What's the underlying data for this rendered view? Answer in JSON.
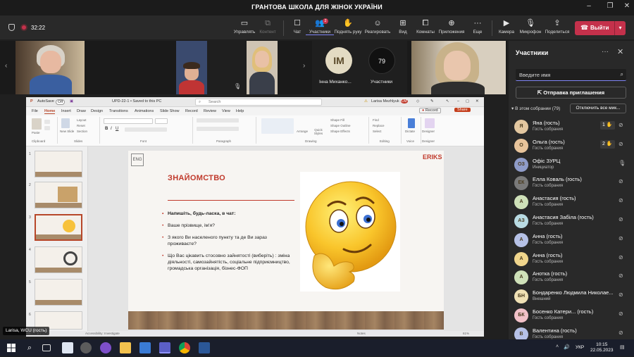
{
  "window": {
    "title": "ГРАНТОВА ШКОЛА ДЛЯ ЖІНОК УКРАЇНИ",
    "controls": [
      "–",
      "❐",
      "✕"
    ]
  },
  "meeting": {
    "elapsed": "32:22",
    "toolbar": {
      "manage": "Управлять",
      "content": "Контент",
      "chat": "Чат",
      "participants": "Участники",
      "participants_badge": "2",
      "raise_hand": "Поднять руку",
      "react": "Реагировать",
      "view": "Вид",
      "rooms": "Комнаты",
      "apps": "Приложения",
      "more": "Еще",
      "camera": "Камера",
      "mic": "Микрофон",
      "share": "Поделиться",
      "leave": "Выйти"
    }
  },
  "strip": {
    "tile_im_initials": "IM",
    "tile_im_name": "Інна Миханко...",
    "more_count": "79",
    "more_label": "Участники"
  },
  "ppt": {
    "app": "AutoSave",
    "toggle": "Off",
    "filename": "UPD-22-1 • Saved to this PC",
    "search": "Search",
    "user": "Larisa Mezhlyuk",
    "user_initials": "LM",
    "menu": [
      "File",
      "Home",
      "Insert",
      "Draw",
      "Design",
      "Transitions",
      "Animations",
      "Slide Show",
      "Record",
      "Review",
      "View",
      "Help"
    ],
    "record_btn": "Record",
    "share_btn": "Share",
    "ribbon_groups": [
      "Clipboard",
      "Slides",
      "Font",
      "Paragraph",
      "Drawing",
      "Editing",
      "Voice",
      "Designer"
    ],
    "ribbon_labels": {
      "paste": "Paste",
      "new_slide": "New Slide",
      "layout": "Layout",
      "reset": "Reset",
      "section": "Section",
      "arrange": "Arrange",
      "quick_styles": "Quick Styles",
      "shape_fill": "Shape Fill",
      "shape_outline": "Shape Outline",
      "shape_effects": "Shape Effects",
      "find": "Find",
      "replace": "Replace",
      "select": "Select",
      "dictate": "Dictate",
      "designer": "Designer"
    },
    "thumbnails": [
      "1",
      "2",
      "3",
      "4",
      "5",
      "6"
    ],
    "status": {
      "slide": "Slide 3 of 67",
      "accessibility": "Accessibility: Investigate",
      "notes": "Notes",
      "zoom": "61%"
    }
  },
  "slide": {
    "logo": "ENG",
    "brand": "ERIKS",
    "title": "ЗНАЙОМСТВО",
    "bullets": [
      "Напишіть, будь-ласка, в чат:",
      "Ваше прізвище, ім'я?",
      "З якого Ви населеного пункту та де Ви зараз проживаєте?",
      "Що Вас цікавить стосовно зайнятості (виберіть) : зміна діяльності, самозайнятість, соціальне підприємництво, громадська організація, бізнес-ФОП"
    ]
  },
  "presenter_tag": "Larisa, WCU (гость)",
  "panel": {
    "title": "Участники",
    "search_placeholder": "Введите имя",
    "invite": "Отправка приглашения",
    "in_meeting": "В этом собрании (79)",
    "mute_all": "Отключить все мик...",
    "participants": [
      {
        "name": "Яна (гость)",
        "role": "Гость собрания",
        "initials": "Я",
        "color": "#e3c7a0",
        "hand": "1",
        "mic": "muted"
      },
      {
        "name": "Ольга (гость)",
        "role": "Гость собрания",
        "initials": "О",
        "color": "#e8c49b",
        "hand": "2",
        "mic": "muted"
      },
      {
        "name": "Офіс ЗУРЦ",
        "role": "Инициатор",
        "initials": "ОЗ",
        "color": "#8f9cc9",
        "hand": "",
        "mic": "on"
      },
      {
        "name": "Елла Коваль (гость)",
        "role": "Гость собрания",
        "initials": "ЕК",
        "color": "#7a7a7a",
        "hand": "",
        "mic": "muted"
      },
      {
        "name": "Анастасия (гость)",
        "role": "Гость собрания",
        "initials": "А",
        "color": "#cfe1b9",
        "hand": "",
        "mic": "muted"
      },
      {
        "name": "Анастасия Забіла (гость)",
        "role": "Гость собрания",
        "initials": "АЗ",
        "color": "#b9dbe3",
        "hand": "",
        "mic": "muted"
      },
      {
        "name": "Анна (гость)",
        "role": "Гость собрания",
        "initials": "А",
        "color": "#b6c1e6",
        "hand": "",
        "mic": "muted"
      },
      {
        "name": "Анна (гость)",
        "role": "Гость собрания",
        "initials": "А",
        "color": "#f0d58c",
        "hand": "",
        "mic": "muted"
      },
      {
        "name": "Анотка (гость)",
        "role": "Гость собрания",
        "initials": "А",
        "color": "#cfe1b9",
        "hand": "",
        "mic": "muted"
      },
      {
        "name": "Бондаренко Людмила Николае...",
        "role": "Внешний",
        "initials": "БН",
        "color": "#efe0b4",
        "hand": "",
        "mic": "muted"
      },
      {
        "name": "Босенко Катери... (гость)",
        "role": "Гость собрания",
        "initials": "БК",
        "color": "#f2c1c8",
        "hand": "",
        "mic": "muted"
      },
      {
        "name": "Валентина (гость)",
        "role": "Гость собрания",
        "initials": "В",
        "color": "#b6c1e6",
        "hand": "",
        "mic": "muted"
      }
    ]
  },
  "taskbar": {
    "lang": "УКР",
    "time": "10:15",
    "date": "22.05.2023"
  }
}
